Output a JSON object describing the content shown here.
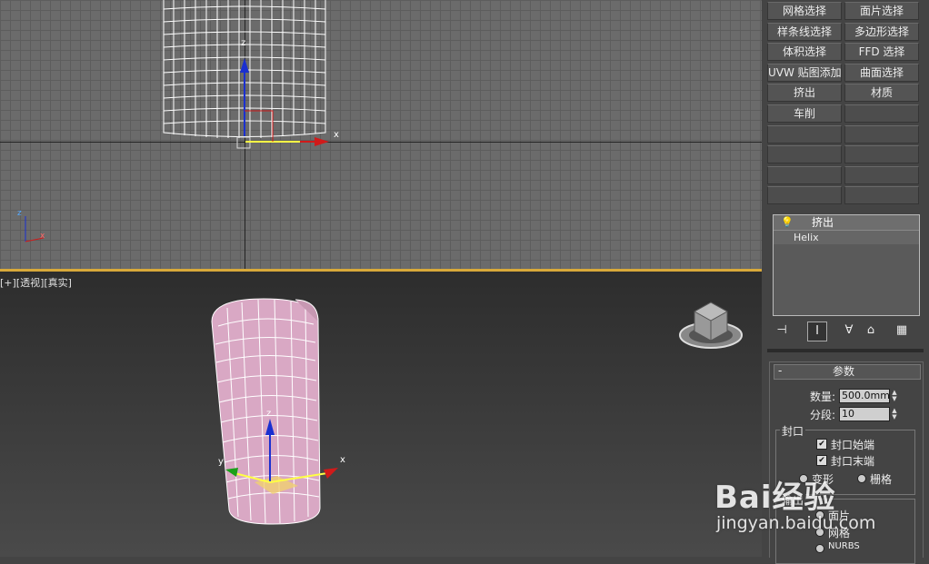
{
  "viewport_top": {
    "axis_labels": {
      "z": "z",
      "x": "x"
    },
    "corner_axes": {
      "z": "z",
      "x": "x"
    }
  },
  "viewport_persp": {
    "label": "[+][透视][真实]",
    "gizmo_labels": {
      "z": "z",
      "x": "x",
      "y": "y"
    }
  },
  "modifier_buttons": [
    {
      "label": "网格选择"
    },
    {
      "label": "面片选择"
    },
    {
      "label": "样条线选择"
    },
    {
      "label": "多边形选择"
    },
    {
      "label": "体积选择"
    },
    {
      "label": "FFD 选择"
    },
    {
      "label": "UVW 贴图添加"
    },
    {
      "label": "曲面选择"
    },
    {
      "label": "挤出"
    },
    {
      "label": "材质"
    },
    {
      "label": "车削"
    },
    {
      "label": ""
    },
    {
      "label": ""
    },
    {
      "label": ""
    },
    {
      "label": ""
    },
    {
      "label": ""
    },
    {
      "label": ""
    },
    {
      "label": ""
    },
    {
      "label": ""
    },
    {
      "label": ""
    }
  ],
  "modifier_stack": {
    "items": [
      {
        "label": "挤出",
        "icon": "lightbulb-icon"
      },
      {
        "label": "Helix"
      }
    ]
  },
  "stack_toolbar": {
    "icons": [
      "pin-stack-icon",
      "show-end-result-icon",
      "make-unique-icon",
      "remove-modifier-icon",
      "configure-modifier-sets-icon"
    ]
  },
  "parameters": {
    "collapse_symbol": "-",
    "title": "参数",
    "amount_label": "数量:",
    "amount_value": "500.0mm",
    "segments_label": "分段:",
    "segments_value": "10",
    "capping_group": "封口",
    "cap_start_label": "封口始端",
    "cap_start_checked": true,
    "cap_end_label": "封口末端",
    "cap_end_checked": true,
    "morph_label": "变形",
    "grid_label": "栅格",
    "output_group": "输出",
    "output_options": [
      {
        "label": "面片"
      },
      {
        "label": "网格"
      },
      {
        "label": "NURBS"
      }
    ]
  },
  "watermark": {
    "logo": "Bai经验",
    "url": "jingyan.baidu.com"
  },
  "colors": {
    "viewport_grid_bg": "#6b6b6b",
    "active_viewport_border": "#d8a93a",
    "wireframe_white": "#ffffff",
    "extruded_mesh_fill": "#d9a8c4",
    "gizmo_z": "#1a2fd0",
    "gizmo_x": "#d01a1a",
    "gizmo_y": "#1aa01a"
  }
}
